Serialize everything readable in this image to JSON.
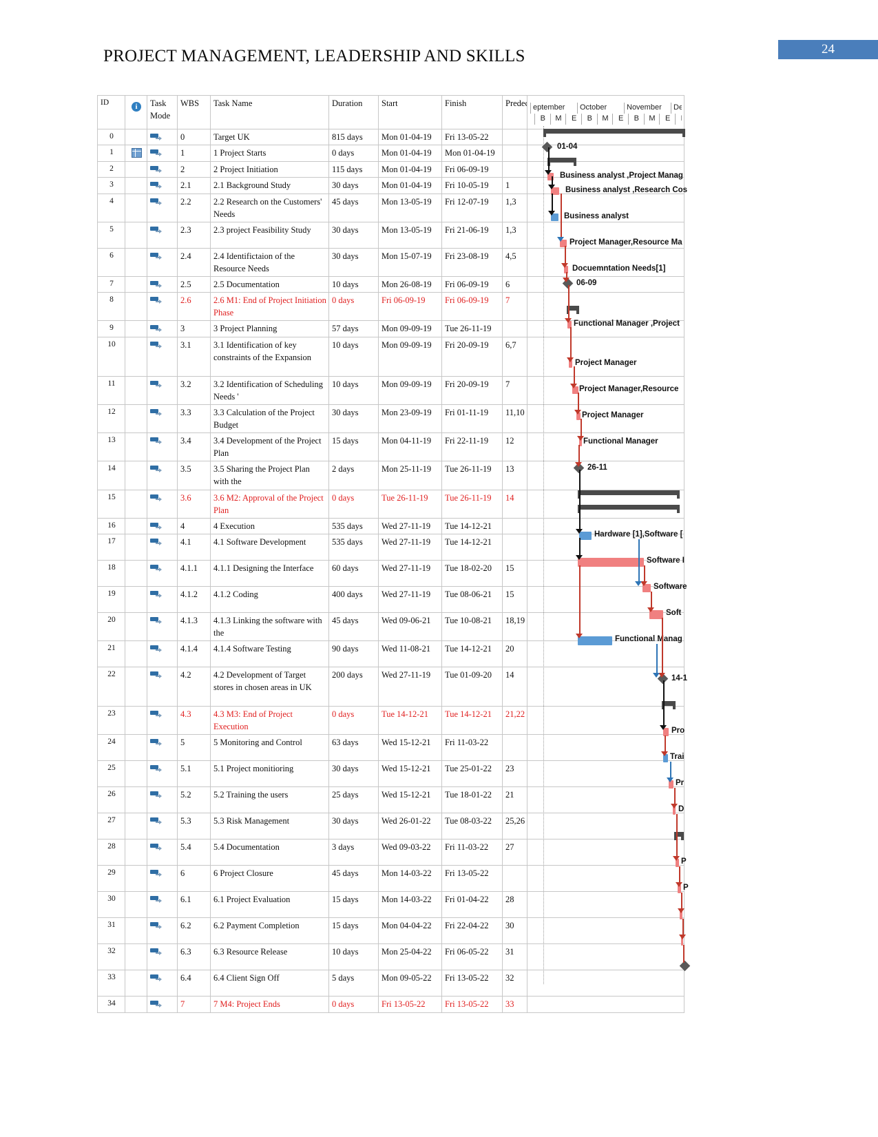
{
  "header": {
    "title": "PROJECT MANAGEMENT, LEADERSHIP AND SKILLS",
    "page_number": "24",
    "badge_color": "#4a7ebb"
  },
  "table": {
    "columns": {
      "id": "ID",
      "indicator": "i",
      "task_mode_l1": "Task",
      "task_mode_l2": "Mode",
      "wbs": "WBS",
      "task_name": "Task Name",
      "duration": "Duration",
      "start": "Start",
      "finish": "Finish",
      "predecessors": "Predec"
    },
    "rows": [
      {
        "id": "0",
        "wbs": "0",
        "name": "Target UK",
        "indent": 0,
        "bold": true,
        "red": false,
        "duration": "815 days",
        "start": "Mon 01-04-19",
        "finish": "Fri 13-05-22",
        "pred": "",
        "note": false
      },
      {
        "id": "1",
        "wbs": "1",
        "name": "1 Project Starts",
        "indent": 1,
        "bold": false,
        "red": false,
        "duration": "0 days",
        "start": "Mon 01-04-19",
        "finish": "Mon 01-04-19",
        "pred": "",
        "note": true
      },
      {
        "id": "2",
        "wbs": "2",
        "name": "2 Project Initiation",
        "indent": 1,
        "bold": true,
        "red": false,
        "duration": "115 days",
        "start": "Mon 01-04-19",
        "finish": "Fri 06-09-19",
        "pred": "",
        "note": false
      },
      {
        "id": "3",
        "wbs": "2.1",
        "name": "2.1 Background Study",
        "indent": 2,
        "bold": false,
        "red": false,
        "duration": "30 days",
        "start": "Mon 01-04-19",
        "finish": "Fri 10-05-19",
        "pred": "1",
        "note": false
      },
      {
        "id": "4",
        "wbs": "2.2",
        "name": "2.2 Research on the Customers' Needs",
        "indent": 2,
        "bold": false,
        "red": false,
        "duration": "45 days",
        "start": "Mon 13-05-19",
        "finish": "Fri 12-07-19",
        "pred": "1,3",
        "note": false
      },
      {
        "id": "5",
        "wbs": "2.3",
        "name": "2.3 project Feasibility Study",
        "indent": 2,
        "bold": false,
        "red": false,
        "duration": "30 days",
        "start": "Mon 13-05-19",
        "finish": "Fri 21-06-19",
        "pred": "1,3",
        "note": false
      },
      {
        "id": "6",
        "wbs": "2.4",
        "name": "2.4 Identifictaion of the Resource Needs",
        "indent": 2,
        "bold": false,
        "red": false,
        "duration": "30 days",
        "start": "Mon 15-07-19",
        "finish": "Fri 23-08-19",
        "pred": "4,5",
        "note": false
      },
      {
        "id": "7",
        "wbs": "2.5",
        "name": "2.5 Documentation",
        "indent": 2,
        "bold": false,
        "red": false,
        "duration": "10 days",
        "start": "Mon 26-08-19",
        "finish": "Fri 06-09-19",
        "pred": "6",
        "note": false
      },
      {
        "id": "8",
        "wbs": "2.6",
        "name": "2.6 M1: End of Project Initiation Phase",
        "indent": 2,
        "bold": false,
        "red": true,
        "duration": "0 days",
        "start": "Fri 06-09-19",
        "finish": "Fri 06-09-19",
        "pred": "7",
        "note": false
      },
      {
        "id": "9",
        "wbs": "3",
        "name": "3 Project Planning",
        "indent": 1,
        "bold": true,
        "red": false,
        "duration": "57 days",
        "start": "Mon 09-09-19",
        "finish": "Tue 26-11-19",
        "pred": "",
        "note": false
      },
      {
        "id": "10",
        "wbs": "3.1",
        "name": "3.1 Identification of key constraints of the Expansion",
        "indent": 2,
        "bold": false,
        "red": false,
        "duration": "10 days",
        "start": "Mon 09-09-19",
        "finish": "Fri 20-09-19",
        "pred": "6,7",
        "note": false
      },
      {
        "id": "11",
        "wbs": "3.2",
        "name": "3.2 Identification of Scheduling Needs '",
        "indent": 2,
        "bold": false,
        "red": false,
        "duration": "10 days",
        "start": "Mon 09-09-19",
        "finish": "Fri 20-09-19",
        "pred": "7",
        "note": false
      },
      {
        "id": "12",
        "wbs": "3.3",
        "name": "3.3 Calculation of the Project Budget",
        "indent": 2,
        "bold": false,
        "red": false,
        "duration": "30 days",
        "start": "Mon 23-09-19",
        "finish": "Fri 01-11-19",
        "pred": "11,10",
        "note": false
      },
      {
        "id": "13",
        "wbs": "3.4",
        "name": "3.4 Development of the Project Plan",
        "indent": 2,
        "bold": false,
        "red": false,
        "duration": "15 days",
        "start": "Mon 04-11-19",
        "finish": "Fri 22-11-19",
        "pred": "12",
        "note": false
      },
      {
        "id": "14",
        "wbs": "3.5",
        "name": "3.5 Sharing the Project Plan with the",
        "indent": 2,
        "bold": false,
        "red": false,
        "duration": "2 days",
        "start": "Mon 25-11-19",
        "finish": "Tue 26-11-19",
        "pred": "13",
        "note": false
      },
      {
        "id": "15",
        "wbs": "3.6",
        "name": "3.6 M2: Approval of the Project Plan",
        "indent": 2,
        "bold": false,
        "red": true,
        "duration": "0 days",
        "start": "Tue 26-11-19",
        "finish": "Tue 26-11-19",
        "pred": "14",
        "note": false
      },
      {
        "id": "16",
        "wbs": "4",
        "name": "4 Execution",
        "indent": 1,
        "bold": true,
        "red": false,
        "duration": "535 days",
        "start": "Wed 27-11-19",
        "finish": "Tue 14-12-21",
        "pred": "",
        "note": false
      },
      {
        "id": "17",
        "wbs": "4.1",
        "name": "4.1 Software Development",
        "indent": 2,
        "bold": true,
        "red": false,
        "duration": "535 days",
        "start": "Wed 27-11-19",
        "finish": "Tue 14-12-21",
        "pred": "",
        "note": false
      },
      {
        "id": "18",
        "wbs": "4.1.1",
        "name": "4.1.1 Designing the Interface",
        "indent": 3,
        "bold": false,
        "red": false,
        "duration": "60 days",
        "start": "Wed 27-11-19",
        "finish": "Tue 18-02-20",
        "pred": "15",
        "note": false
      },
      {
        "id": "19",
        "wbs": "4.1.2",
        "name": "4.1.2 Coding",
        "indent": 3,
        "bold": false,
        "red": false,
        "duration": "400 days",
        "start": "Wed 27-11-19",
        "finish": "Tue 08-06-21",
        "pred": "15",
        "note": false
      },
      {
        "id": "20",
        "wbs": "4.1.3",
        "name": "4.1.3 Linking the software with the",
        "indent": 3,
        "bold": false,
        "red": false,
        "duration": "45 days",
        "start": "Wed 09-06-21",
        "finish": "Tue 10-08-21",
        "pred": "18,19",
        "note": false
      },
      {
        "id": "21",
        "wbs": "4.1.4",
        "name": "4.1.4 Software Testing",
        "indent": 3,
        "bold": false,
        "red": false,
        "duration": "90 days",
        "start": "Wed 11-08-21",
        "finish": "Tue 14-12-21",
        "pred": "20",
        "note": false
      },
      {
        "id": "22",
        "wbs": "4.2",
        "name": "4.2 Development of Target stores in chosen areas in UK",
        "indent": 2,
        "bold": false,
        "red": false,
        "duration": "200 days",
        "start": "Wed 27-11-19",
        "finish": "Tue 01-09-20",
        "pred": "14",
        "note": false
      },
      {
        "id": "23",
        "wbs": "4.3",
        "name": "4.3 M3: End of Project Execution",
        "indent": 2,
        "bold": false,
        "red": true,
        "duration": "0 days",
        "start": "Tue 14-12-21",
        "finish": "Tue 14-12-21",
        "pred": "21,22",
        "note": false
      },
      {
        "id": "24",
        "wbs": "5",
        "name": "5 Monitoring and Control",
        "indent": 1,
        "bold": true,
        "red": false,
        "duration": "63 days",
        "start": "Wed 15-12-21",
        "finish": "Fri 11-03-22",
        "pred": "",
        "note": false
      },
      {
        "id": "25",
        "wbs": "5.1",
        "name": "5.1 Project monitioring",
        "indent": 2,
        "bold": false,
        "red": false,
        "duration": "30 days",
        "start": "Wed 15-12-21",
        "finish": "Tue 25-01-22",
        "pred": "23",
        "note": false
      },
      {
        "id": "26",
        "wbs": "5.2",
        "name": "5.2 Training the users",
        "indent": 2,
        "bold": false,
        "red": false,
        "duration": "25 days",
        "start": "Wed 15-12-21",
        "finish": "Tue 18-01-22",
        "pred": "21",
        "note": false
      },
      {
        "id": "27",
        "wbs": "5.3",
        "name": "5.3 Risk Management",
        "indent": 2,
        "bold": false,
        "red": false,
        "duration": "30 days",
        "start": "Wed 26-01-22",
        "finish": "Tue 08-03-22",
        "pred": "25,26",
        "note": false
      },
      {
        "id": "28",
        "wbs": "5.4",
        "name": "5.4 Documentation",
        "indent": 2,
        "bold": false,
        "red": false,
        "duration": "3 days",
        "start": "Wed 09-03-22",
        "finish": "Fri 11-03-22",
        "pred": "27",
        "note": false
      },
      {
        "id": "29",
        "wbs": "6",
        "name": "6 Project Closure",
        "indent": 1,
        "bold": true,
        "red": false,
        "duration": "45 days",
        "start": "Mon 14-03-22",
        "finish": "Fri 13-05-22",
        "pred": "",
        "note": false
      },
      {
        "id": "30",
        "wbs": "6.1",
        "name": "6.1 Project Evaluation",
        "indent": 2,
        "bold": false,
        "red": false,
        "duration": "15 days",
        "start": "Mon 14-03-22",
        "finish": "Fri 01-04-22",
        "pred": "28",
        "note": false
      },
      {
        "id": "31",
        "wbs": "6.2",
        "name": "6.2 Payment Completion",
        "indent": 2,
        "bold": false,
        "red": false,
        "duration": "15 days",
        "start": "Mon 04-04-22",
        "finish": "Fri 22-04-22",
        "pred": "30",
        "note": false
      },
      {
        "id": "32",
        "wbs": "6.3",
        "name": "6.3 Resource Release",
        "indent": 2,
        "bold": false,
        "red": false,
        "duration": "10 days",
        "start": "Mon 25-04-22",
        "finish": "Fri 06-05-22",
        "pred": "31",
        "note": false
      },
      {
        "id": "33",
        "wbs": "6.4",
        "name": "6.4 Client Sign Off",
        "indent": 2,
        "bold": false,
        "red": false,
        "duration": "5 days",
        "start": "Mon 09-05-22",
        "finish": "Fri 13-05-22",
        "pred": "32",
        "note": false
      },
      {
        "id": "34",
        "wbs": "7",
        "name": "7 M4: Project Ends",
        "indent": 1,
        "bold": false,
        "red": true,
        "duration": "0 days",
        "start": "Fri 13-05-22",
        "finish": "Fri 13-05-22",
        "pred": "33",
        "note": false
      }
    ]
  },
  "gantt": {
    "timeline_months": [
      "eptember",
      "October",
      "November",
      "Decem"
    ],
    "timeline_sub": [
      "B",
      "M",
      "E",
      "B",
      "M",
      "E",
      "B",
      "M",
      "E",
      "B"
    ],
    "bar_colors": {
      "task": "#f08080",
      "secondary": "#5b9bd5",
      "summary": "#4a4a4a",
      "milestone": "#595959",
      "link": "#c0392b"
    },
    "annotations": [
      {
        "text": "01-04",
        "row": 1
      },
      {
        "text": "Business analyst ,Project Manag",
        "row": 3
      },
      {
        "text": "Business analyst ,Research Cos",
        "row": 4
      },
      {
        "text": "Business analyst",
        "row": 5
      },
      {
        "text": "Project Manager,Resource Ma",
        "row": 6
      },
      {
        "text": "Docuemntation Needs[1]",
        "row": 7
      },
      {
        "text": "06-09",
        "row": 8
      },
      {
        "text": "Functional Manager ,Project",
        "row": 10
      },
      {
        "text": "Project Manager",
        "row": 11
      },
      {
        "text": "Project Manager,Resource",
        "row": 12
      },
      {
        "text": "Project Manager",
        "row": 13
      },
      {
        "text": "Functional Manager",
        "row": 14
      },
      {
        "text": "26-11",
        "row": 15
      },
      {
        "text": "Hardware [1],Software [",
        "row": 18
      },
      {
        "text": "Software I",
        "row": 19
      },
      {
        "text": "Software",
        "row": 20
      },
      {
        "text": "Soft",
        "row": 21
      },
      {
        "text": "Functional Manag",
        "row": 22
      },
      {
        "text": "14-1",
        "row": 23
      },
      {
        "text": "Pro",
        "row": 25
      },
      {
        "text": "Trai",
        "row": 26
      },
      {
        "text": "Pr",
        "row": 27
      },
      {
        "text": "D",
        "row": 28
      },
      {
        "text": "P",
        "row": 30
      },
      {
        "text": "P",
        "row": 31
      },
      {
        "text": "",
        "row": 32
      }
    ]
  }
}
